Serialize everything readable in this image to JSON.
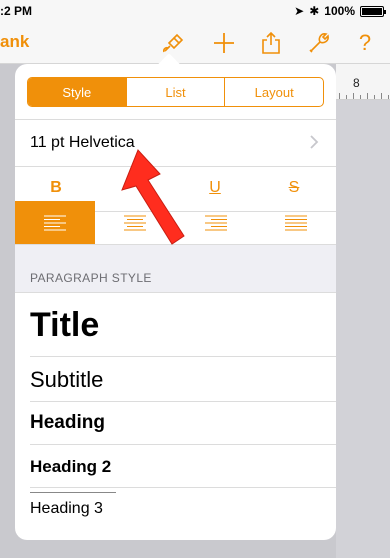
{
  "status_bar": {
    "time_fragment": ":2 PM",
    "battery": "100%",
    "battery_level": 1.0
  },
  "toolbar": {
    "back_label": "ank",
    "icons": [
      "paintbrush-icon",
      "plus-icon",
      "share-icon",
      "wrench-icon",
      "help-icon"
    ]
  },
  "ruler": {
    "number": "8"
  },
  "popover": {
    "tabs": [
      {
        "label": "Style",
        "active": true
      },
      {
        "label": "List",
        "active": false
      },
      {
        "label": "Layout",
        "active": false
      }
    ],
    "font": {
      "label": "11 pt Helvetica"
    },
    "format": {
      "bold": "B",
      "underline": "U",
      "strike": "S"
    },
    "alignment": {
      "options": [
        "left",
        "center",
        "right",
        "justify"
      ],
      "active": "left"
    },
    "paragraph_header": "PARAGRAPH STYLE",
    "styles": [
      "Title",
      "Subtitle",
      "Heading",
      "Heading 2",
      "Heading 3"
    ]
  },
  "colors": {
    "accent": "#f0900a",
    "annotation": "#ff2d1e"
  }
}
